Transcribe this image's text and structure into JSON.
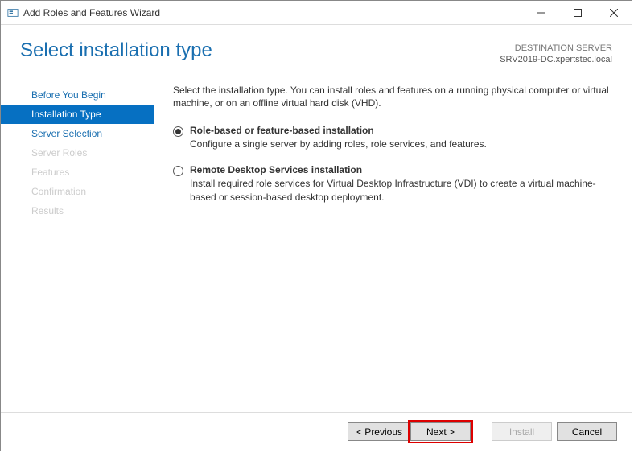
{
  "titlebar": {
    "title": "Add Roles and Features Wizard"
  },
  "header": {
    "page_title": "Select installation type",
    "destination_label": "DESTINATION SERVER",
    "destination_value": "SRV2019-DC.xpertstec.local"
  },
  "sidebar": {
    "items": [
      {
        "label": "Before You Begin",
        "state": "enabled"
      },
      {
        "label": "Installation Type",
        "state": "active"
      },
      {
        "label": "Server Selection",
        "state": "enabled"
      },
      {
        "label": "Server Roles",
        "state": "disabled"
      },
      {
        "label": "Features",
        "state": "disabled"
      },
      {
        "label": "Confirmation",
        "state": "disabled"
      },
      {
        "label": "Results",
        "state": "disabled"
      }
    ]
  },
  "main": {
    "intro": "Select the installation type. You can install roles and features on a running physical computer or virtual machine, or on an offline virtual hard disk (VHD).",
    "options": [
      {
        "title": "Role-based or feature-based installation",
        "desc": "Configure a single server by adding roles, role services, and features.",
        "selected": true
      },
      {
        "title": "Remote Desktop Services installation",
        "desc": "Install required role services for Virtual Desktop Infrastructure (VDI) to create a virtual machine-based or session-based desktop deployment.",
        "selected": false
      }
    ]
  },
  "footer": {
    "previous": "< Previous",
    "next": "Next >",
    "install": "Install",
    "cancel": "Cancel"
  }
}
